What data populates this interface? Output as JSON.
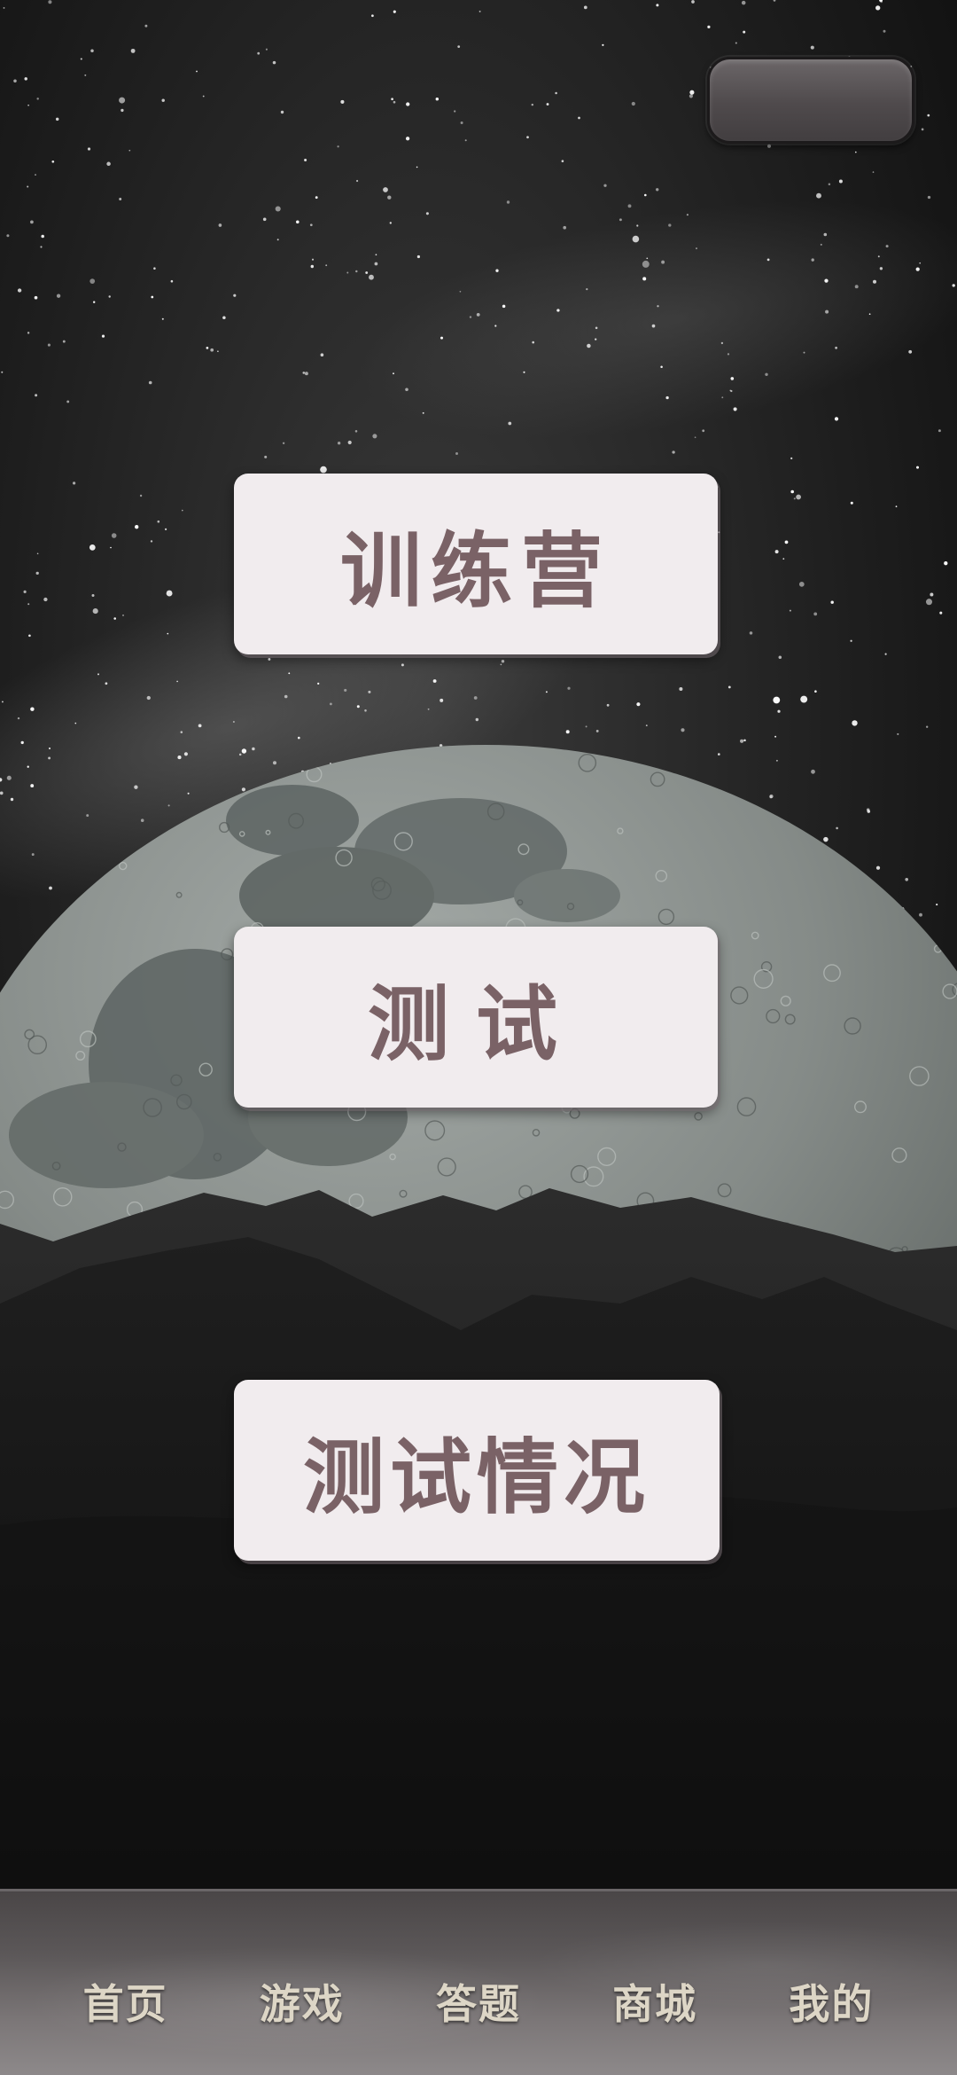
{
  "menu": {
    "training_camp": "训练营",
    "test": "测试",
    "test_results": "测试情况"
  },
  "nav": {
    "items": [
      {
        "label": "首页"
      },
      {
        "label": "游戏"
      },
      {
        "label": "答题"
      },
      {
        "label": "商城"
      },
      {
        "label": "我的"
      }
    ]
  },
  "colors": {
    "button_bg": "#f1ecee",
    "button_text": "#7a6266",
    "nav_text": "#ddd6c6"
  }
}
